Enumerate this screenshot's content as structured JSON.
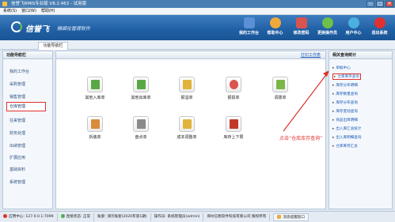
{
  "window": {
    "title": "信誉飞RMIS专业版 V8.2.463 - 试用版",
    "controls": [
      "–",
      "□",
      "✕"
    ]
  },
  "menu": [
    "系统(S)",
    "窗口(W)",
    "帮助(H)"
  ],
  "banner": {
    "brand": "信誉飞",
    "slogan": "精细化管理软件"
  },
  "toolbar": [
    {
      "label": "我的工作台",
      "icon": "monitor-icon",
      "color": "#5b8fd6"
    },
    {
      "label": "帮助中心",
      "icon": "help-icon",
      "color": "#f0a93a"
    },
    {
      "label": "修改密码",
      "icon": "key-icon",
      "color": "#d9534f"
    },
    {
      "label": "更换操作员",
      "icon": "user-switch-icon",
      "color": "#6fc04a"
    },
    {
      "label": "用户中心",
      "icon": "user-center-icon",
      "color": "#4ab0e0"
    },
    {
      "label": "退出系统",
      "icon": "power-icon",
      "color": "#e0302f"
    }
  ],
  "tab": {
    "label": "功能导航栏"
  },
  "left_nav": {
    "title": "功能导航栏",
    "items": [
      "我的工作台",
      "采购管理",
      "销售管理",
      "仓库管理",
      "往来管理",
      "财务处理",
      "出纳管理",
      "扩展应用",
      "基础资料",
      "系统管理"
    ],
    "active_index": 3
  },
  "main": {
    "print_link": "打印工作表",
    "modules_row1": [
      {
        "label": "其他入库单",
        "icon": "stock-in-icon",
        "color": "#5aa845"
      },
      {
        "label": "其他出库单",
        "icon": "stock-out-icon",
        "color": "#5aa845"
      },
      {
        "label": "报溢单",
        "icon": "overflow-icon",
        "color": "#e0b43a"
      },
      {
        "label": "报损单",
        "icon": "loss-icon",
        "color": "#d9534f"
      },
      {
        "label": "调拨单",
        "icon": "transfer-icon",
        "color": "#7ab648"
      }
    ],
    "modules_row2": [
      {
        "label": "拆装单",
        "icon": "assembly-icon",
        "color": "#d98c3a"
      },
      {
        "label": "盘点单",
        "icon": "inventory-check-icon",
        "color": "#8a8a8a"
      },
      {
        "label": "成本调整单",
        "icon": "cost-adjust-icon",
        "color": "#e0b43a"
      },
      {
        "label": "库存上下限",
        "icon": "stock-limit-icon",
        "color": "#c0392b"
      }
    ]
  },
  "annotation": {
    "text": "点击“仓库库存查询”"
  },
  "right_panel": {
    "title": "相关查询统计",
    "items": [
      "单据中心",
      "仓库库存查询",
      "库存分布明细",
      "库存数量查询",
      "库存分布查询",
      "库存变动查询",
      "商品出库明细",
      "出入库汇总统计",
      "出入库明细查询",
      "仓库库存汇总"
    ],
    "active_index": 1
  },
  "status": {
    "center": "应用中心: 127.0.0.1:7099",
    "connection": "连接状态: 正常",
    "account": "账套: 演示账套(2020年第1期)",
    "operator": "操作员: 系统管理员(admin)",
    "company": "郑州信税软件科技有限公司  版权所有",
    "button": "消息提醒窗口"
  },
  "colors": {
    "accent": "#1f5fa3",
    "highlight": "#e0302f"
  }
}
